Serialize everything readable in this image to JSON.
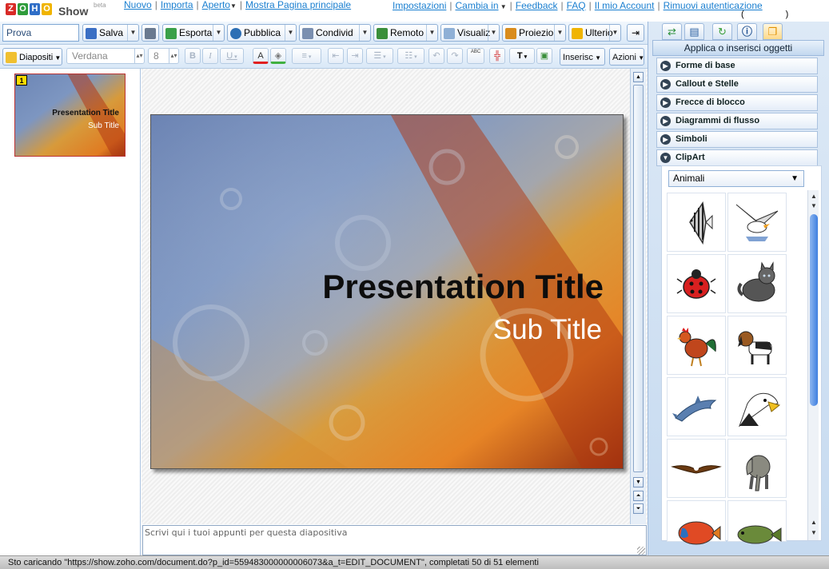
{
  "topbar": {
    "logo_letters": [
      "Z",
      "O",
      "H",
      "O"
    ],
    "logo_colors": [
      "#d82b27",
      "#2f9c3b",
      "#2f6ec7",
      "#f0b400"
    ],
    "app_name": "Show",
    "beta_label": "beta",
    "nav_left": [
      "Nuovo",
      "Importa",
      "Aperto",
      "Mostra Pagina principale"
    ],
    "nav_right": [
      "Impostazioni",
      "Cambia in",
      "Feedback",
      "FAQ",
      "Il mio Account",
      "Rimuovi autenticazione"
    ],
    "bracket_text": "(                 )"
  },
  "toolbar1": {
    "doc_name": "Prova",
    "save_label": "Salva",
    "print_icon": "printer-icon",
    "export_label": "Esporta",
    "publish_label": "Pubblica",
    "share_label": "Condivid",
    "remote_label": "Remoto",
    "view_label": "Visualiz",
    "projection_label": "Proiezio",
    "more_label": "Ulterio",
    "exit_icon": "exit-icon"
  },
  "toolbar2": {
    "slides_label": "Diapositi",
    "font_name": "Verdana",
    "font_size": "8",
    "bold": "B",
    "italic": "I",
    "underline": "U",
    "text_color_glyph": "A",
    "insert_label": "Inserisc",
    "actions_label": "Azioni",
    "text_tool_glyph": "T",
    "spell_glyph": "ABC"
  },
  "right_panel": {
    "header": "Applica o inserisci oggetti",
    "tabs": [
      "apply-icon",
      "layout-icon",
      "refresh-icon",
      "info-icon",
      "copy-icon"
    ],
    "sections": [
      {
        "label": "Forme di base"
      },
      {
        "label": "Callout e Stelle"
      },
      {
        "label": "Frecce di blocco"
      },
      {
        "label": "Diagrammi di flusso"
      },
      {
        "label": "Simboli"
      },
      {
        "label": "ClipArt"
      }
    ],
    "clipart_category": "Animali",
    "clipart_items": [
      "angelfish",
      "seagull",
      "ladybug",
      "cat",
      "rooster",
      "dog",
      "dolphin",
      "eagle",
      "eagle-flying",
      "elephant",
      "tropical-fish",
      "fish"
    ]
  },
  "slides": [
    {
      "number": "1",
      "title": "Presentation Title",
      "subtitle": "Sub Title"
    }
  ],
  "slide": {
    "title": "Presentation Title",
    "subtitle": "Sub Title"
  },
  "notes": {
    "placeholder": "Scrivi qui i tuoi appunti per questa diapositiva"
  },
  "status": {
    "text": "Sto caricando \"https://show.zoho.com/document.do?p_id=559483000000006073&a_t=EDIT_DOCUMENT\", completati 50 di 51 elementi"
  }
}
